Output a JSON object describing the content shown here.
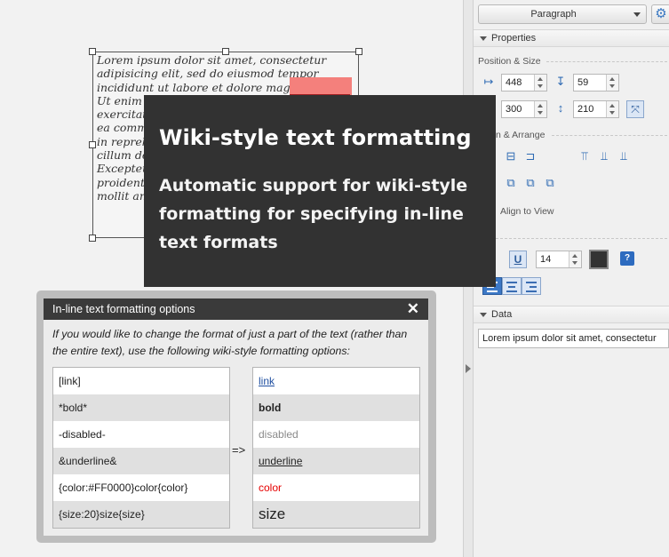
{
  "canvas": {
    "lorem_text": "Lorem ipsum dolor sit amet, consectetur adipisicing elit, sed do eiusmod tempor incididunt ut labore et dolore magna aliqua. Ut enim ad minim veniam, quis nostrud exercitation ullamco laboris nisi ut aliquip ex ea commodo consequat. Duis aute irure dolor in reprehenderit in voluptate velit esse cillum dolore eu fugiat nulla pariatur. Excepteur sint occaecat cupidatat non proident, sunt in culpa qui officia deserunt mollit anim id est laborum."
  },
  "panel": {
    "style_select": "Paragraph",
    "properties_label": "Properties",
    "position_size_label": "Position & Size",
    "x_value": "448",
    "y_value": "59",
    "w_value": "300",
    "h_value": "210",
    "arrange_label": "n & Arrange",
    "align_to_view_label": "Align to View",
    "font_size_value": "14",
    "data_label": "Data",
    "data_value": "Lorem ipsum dolor sit amet, consectetur"
  },
  "tooltip": {
    "title": "Wiki-style text formatting",
    "body": "Automatic support for wiki-style formatting for specifying in-line text formats"
  },
  "dialog": {
    "title": "In-line text formatting options",
    "close": "✕",
    "description": "If you would like to change the format of just a part of the text (rather than the entire text), use the following wiki-style formatting options:",
    "arrow": "=>",
    "syntax": [
      "[link]",
      "*bold*",
      "-disabled-",
      "&underline&",
      "{color:#FF0000}color{color}",
      "{size:20}size{size}"
    ],
    "results": [
      "link",
      "bold",
      "disabled",
      "underline",
      "color",
      "size"
    ]
  },
  "colors": {
    "accent": "#2f6bb4",
    "tooltip_bg": "#323232",
    "link": "#1f4fa0",
    "disabled": "#8a8a8a",
    "red": "#e60000"
  }
}
